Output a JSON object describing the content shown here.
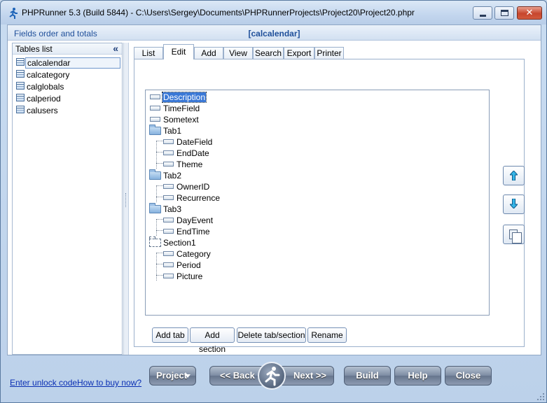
{
  "window": {
    "title": "PHPRunner 5.3 (Build 5844) - C:\\Users\\Sergey\\Documents\\PHPRunnerProjects\\Project20\\Project20.phpr",
    "close_glyph": "✕"
  },
  "header": {
    "left": "Fields order and totals",
    "center": "[calcalendar]"
  },
  "tables_list": {
    "title": "Tables list",
    "collapse_glyph": "«",
    "items": [
      "calcalendar",
      "calcategory",
      "calglobals",
      "calperiod",
      "calusers"
    ],
    "selected": "calcalendar"
  },
  "tabs": [
    "List",
    "Edit",
    "Add",
    "View",
    "Search",
    "Export",
    "Printer"
  ],
  "active_tab": "Edit",
  "tree": [
    {
      "label": "Description",
      "type": "field",
      "level": 0,
      "selected": true
    },
    {
      "label": "TimeField",
      "type": "field",
      "level": 0
    },
    {
      "label": "Sometext",
      "type": "field",
      "level": 0
    },
    {
      "label": "Tab1",
      "type": "tab",
      "level": 0
    },
    {
      "label": "DateField",
      "type": "field",
      "level": 1
    },
    {
      "label": "EndDate",
      "type": "field",
      "level": 1
    },
    {
      "label": "Theme",
      "type": "field",
      "level": 1
    },
    {
      "label": "Tab2",
      "type": "tab",
      "level": 0
    },
    {
      "label": "OwnerID",
      "type": "field",
      "level": 1
    },
    {
      "label": "Recurrence",
      "type": "field",
      "level": 1
    },
    {
      "label": "Tab3",
      "type": "tab",
      "level": 0
    },
    {
      "label": "DayEvent",
      "type": "field",
      "level": 1
    },
    {
      "label": "EndTime",
      "type": "field",
      "level": 1
    },
    {
      "label": "Section1",
      "type": "section",
      "level": 0
    },
    {
      "label": "Category",
      "type": "field",
      "level": 1
    },
    {
      "label": "Period",
      "type": "field",
      "level": 1
    },
    {
      "label": "Picture",
      "type": "field",
      "level": 1
    }
  ],
  "tree_actions": {
    "add_tab": "Add tab",
    "add_section": "Add section",
    "delete": "Delete tab/section",
    "rename": "Rename"
  },
  "footer": {
    "unlock_link": "Enter unlock code",
    "buy_link": "How to buy now?",
    "project": "Project",
    "back": "<< Back",
    "next": "Next >>",
    "build": "Build",
    "help": "Help",
    "close": "Close"
  },
  "colors": {
    "accent": "#1f4f9a",
    "arrow": "#1a9bd8",
    "selection": "#3a78d6",
    "link": "#0a2fb3"
  },
  "icons": {
    "app": "runner-icon",
    "move_up": "arrow-up-icon",
    "move_down": "arrow-down-icon",
    "copy": "copy-icon"
  }
}
